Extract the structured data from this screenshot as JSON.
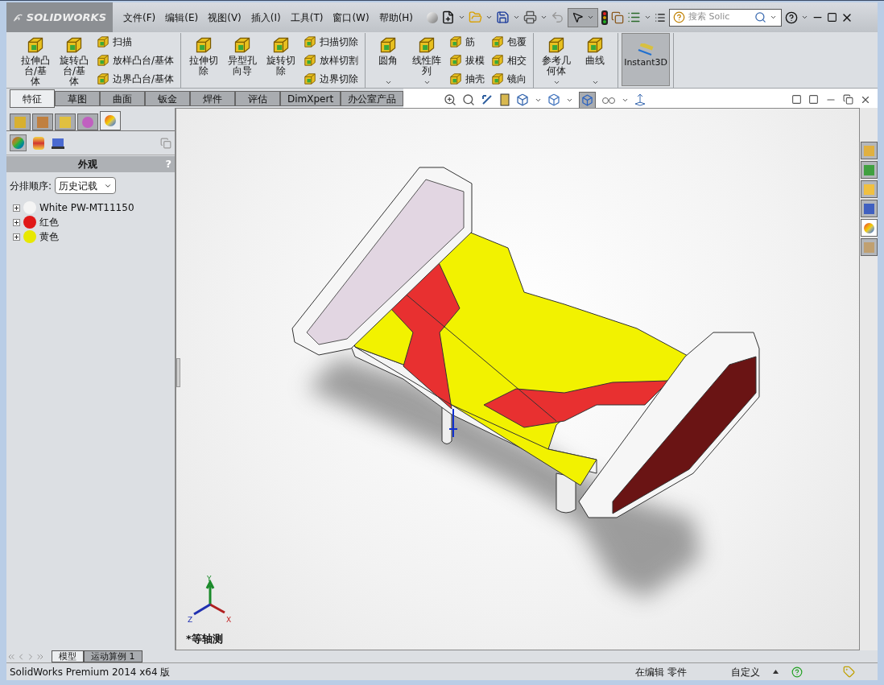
{
  "app": {
    "logo": "SOLIDWORKS"
  },
  "menu": [
    "文件(F)",
    "编辑(E)",
    "视图(V)",
    "插入(I)",
    "工具(T)",
    "窗口(W)",
    "帮助(H)"
  ],
  "quick_toolbar": {
    "search_placeholder": "搜索 Solic"
  },
  "ribbon": {
    "groups": [
      {
        "items": [
          {
            "kind": "large",
            "label": "拉伸凸台/基体"
          },
          {
            "kind": "large",
            "label": "旋转凸台/基体"
          },
          {
            "kind": "column",
            "items": [
              "扫描",
              "放样凸台/基体",
              "边界凸台/基体"
            ]
          }
        ]
      },
      {
        "items": [
          {
            "kind": "large",
            "label": "拉伸切除"
          },
          {
            "kind": "large",
            "label": "异型孔向导"
          },
          {
            "kind": "large",
            "label": "旋转切除"
          },
          {
            "kind": "column",
            "items": [
              "扫描切除",
              "放样切割",
              "边界切除"
            ]
          }
        ]
      },
      {
        "items": [
          {
            "kind": "large",
            "label": "圆角",
            "dropdown": true
          },
          {
            "kind": "large",
            "label": "线性阵列",
            "dropdown": true
          },
          {
            "kind": "column",
            "items": [
              "筋",
              "拔模",
              "抽壳"
            ]
          },
          {
            "kind": "column",
            "items": [
              "包覆",
              "相交",
              "镜向"
            ]
          }
        ]
      },
      {
        "items": [
          {
            "kind": "large",
            "label": "参考几何体",
            "dropdown": true
          },
          {
            "kind": "large",
            "label": "曲线",
            "dropdown": true
          }
        ]
      },
      {
        "items": [
          {
            "kind": "toggle",
            "label": "Instant3D",
            "selected": true
          }
        ]
      }
    ]
  },
  "command_tabs": [
    {
      "label": "特征",
      "selected": true
    },
    {
      "label": "草图",
      "selected": false
    },
    {
      "label": "曲面",
      "selected": false
    },
    {
      "label": "钣金",
      "selected": false
    },
    {
      "label": "焊件",
      "selected": false
    },
    {
      "label": "评估",
      "selected": false
    },
    {
      "label": "DimXpert",
      "selected": false
    },
    {
      "label": "办公室产品",
      "selected": false
    }
  ],
  "panel": {
    "tabs": [
      {
        "selected": false
      },
      {
        "selected": false
      },
      {
        "selected": false
      },
      {
        "selected": false
      },
      {
        "selected": true
      }
    ],
    "title": "外观",
    "help": "?",
    "sort_label": "分排顺序:",
    "sort_value": "历史记载",
    "items": [
      {
        "label": "White PW-MT11150",
        "color": "#f4f4f4"
      },
      {
        "label": "红色",
        "color": "#e01818"
      },
      {
        "label": "黄色",
        "color": "#e8e800"
      }
    ]
  },
  "task_pane": [
    {
      "selected": false
    },
    {
      "selected": false
    },
    {
      "selected": false
    },
    {
      "selected": false
    },
    {
      "selected": true
    },
    {
      "selected": false
    }
  ],
  "viewport": {
    "view_name": "*等轴测",
    "triad": {
      "x": "X",
      "y": "Y",
      "z": "Z"
    }
  },
  "bottom_tabs": [
    {
      "label": "模型",
      "selected": true
    },
    {
      "label": "运动算例 1",
      "selected": false
    }
  ],
  "status_bar": {
    "product": "SolidWorks Premium 2014 x64 版",
    "mode": "在编辑 零件",
    "units": "自定义"
  }
}
